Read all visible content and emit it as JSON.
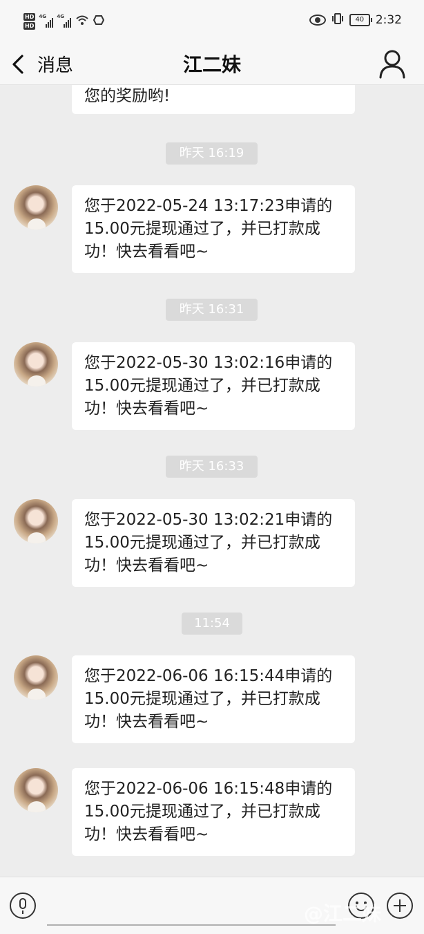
{
  "status_bar": {
    "hd1": "HD",
    "hd2": "HD",
    "sig1_label": "4G",
    "sig2_label": "4G",
    "battery": "40",
    "time": "2:32"
  },
  "nav": {
    "back_label": "消息",
    "title": "江二妹"
  },
  "messages": [
    {
      "text": "您的奖励哟!"
    },
    {
      "timestamp": "昨天 16:19",
      "text": "您于2022-05-24 13:17:23申请的15.00元提现通过了，并已打款成功！快去看看吧~"
    },
    {
      "timestamp": "昨天 16:31",
      "text": "您于2022-05-30 13:02:16申请的15.00元提现通过了，并已打款成功！快去看看吧~"
    },
    {
      "timestamp": "昨天 16:33",
      "text": "您于2022-05-30 13:02:21申请的15.00元提现通过了，并已打款成功！快去看看吧~"
    },
    {
      "timestamp": "11:54",
      "text": "您于2022-06-06 16:15:44申请的15.00元提现通过了，并已打款成功！快去看看吧~"
    },
    {
      "text": "您于2022-06-06 16:15:48申请的15.00元提现通过了，并已打款成功！快去看看吧~"
    }
  ],
  "icons": {
    "back": "chevron-left-icon",
    "profile": "person-icon",
    "voice": "microphone-icon",
    "emoji": "smiley-icon",
    "more": "plus-circle-icon"
  },
  "watermark": "@江二妹"
}
